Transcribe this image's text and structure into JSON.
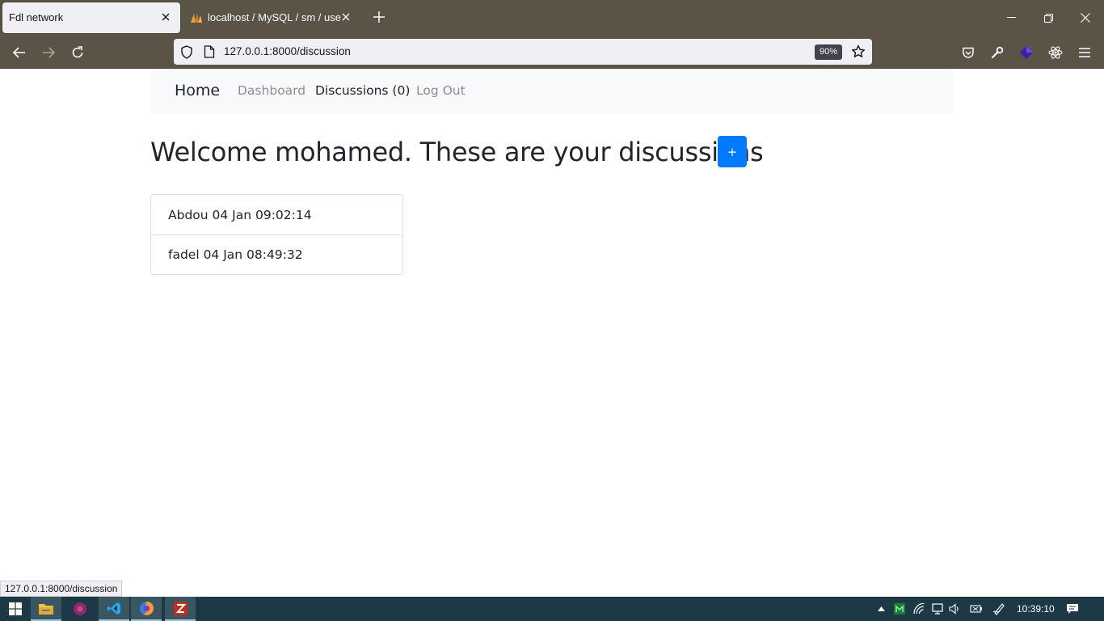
{
  "browser": {
    "tabs": [
      {
        "title": "Fdl network",
        "active": true
      },
      {
        "title": "localhost / MySQL / sm / users |",
        "active": false
      }
    ],
    "url": "127.0.0.1:8000/discussion",
    "zoom": "90%",
    "status_url": "127.0.0.1:8000/discussion"
  },
  "site": {
    "brand": "Home",
    "nav": [
      {
        "label": "Dashboard",
        "active": false
      },
      {
        "label": "Discussions (0)",
        "active": true
      },
      {
        "label": "Log Out",
        "active": false
      }
    ],
    "title": "Welcome mohamed. These are your discussions",
    "add_button_label": "+",
    "discussions": [
      "Abdou 04 Jan 09:02:14",
      "fadel 04 Jan 08:49:32"
    ]
  },
  "taskbar": {
    "clock": "10:39:10"
  },
  "colors": {
    "chrome": "#5a5446",
    "primary_button": "#007bff",
    "taskbar": "#1e3946"
  }
}
